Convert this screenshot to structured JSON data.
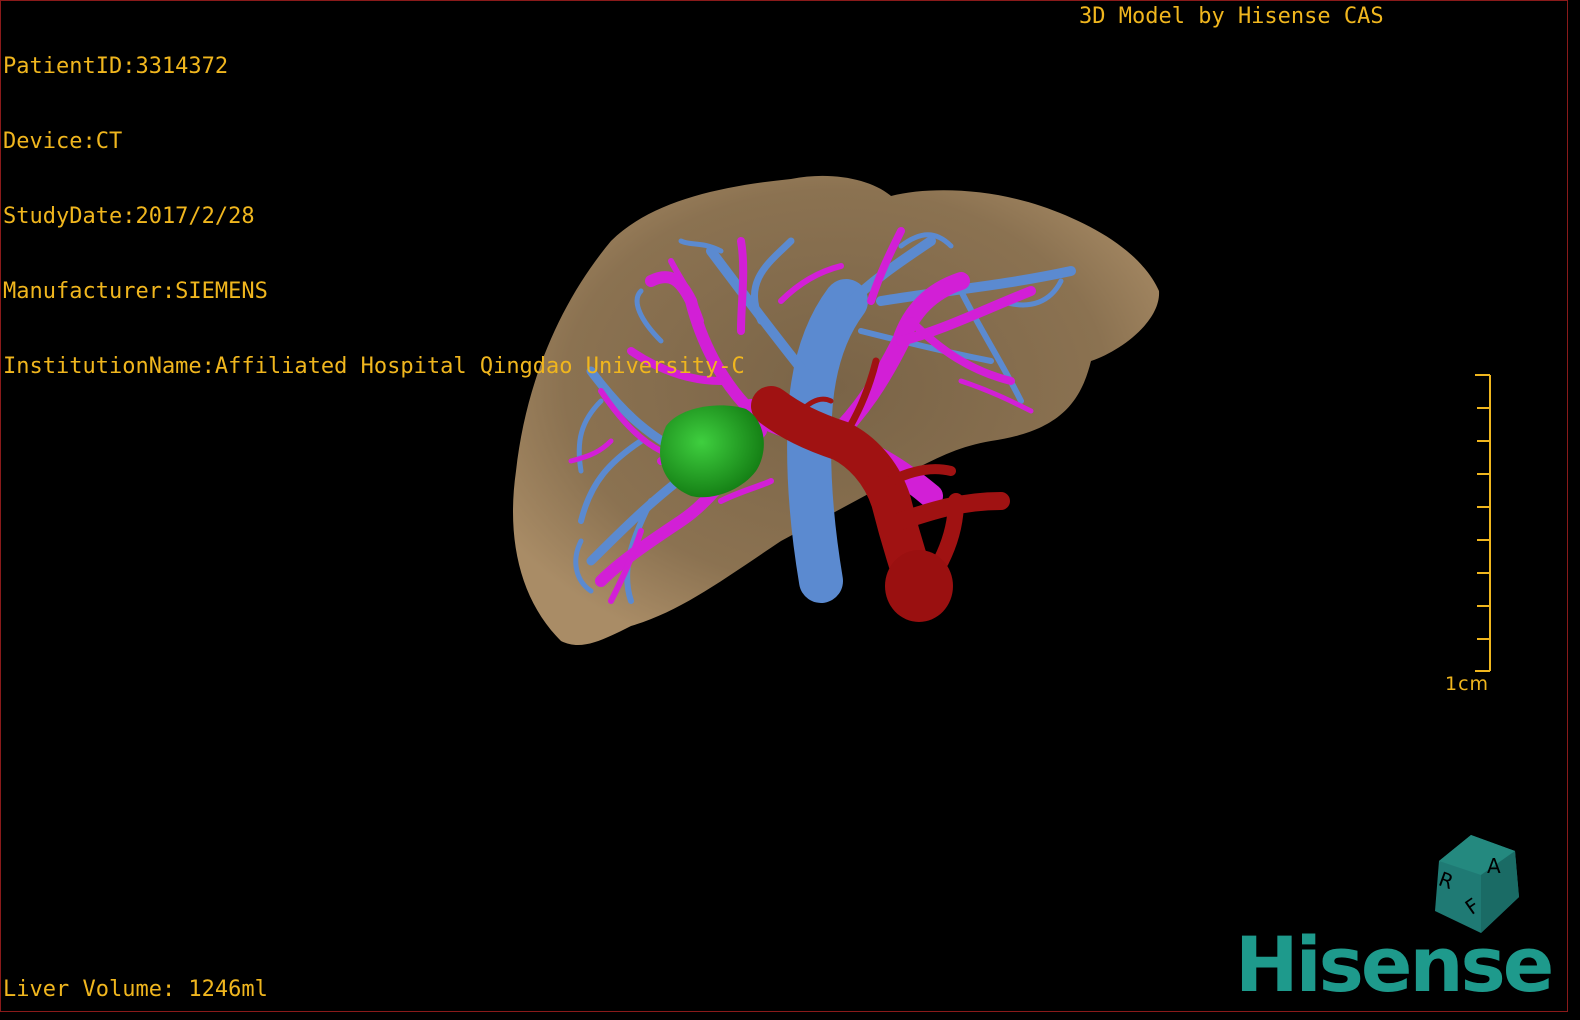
{
  "patient_info": {
    "patient_id": "PatientID:3314372",
    "device": "Device:CT",
    "study_date": "StudyDate:2017/2/28",
    "manufacturer": "Manufacturer:SIEMENS",
    "institution": "InstitutionName:Affiliated Hospital Qingdao University-C"
  },
  "credit": "3D Model by Hisense CAS",
  "liver_volume": "Liver Volume: 1246ml",
  "scale": {
    "label": "1cm"
  },
  "orientation_cube": {
    "letters": [
      "R",
      "A",
      "F"
    ],
    "color": "#1f7a74"
  },
  "brand": {
    "logo_text": "Hisense",
    "color": "#1e9a8c"
  },
  "colors": {
    "overlay_text": "#f0b61e",
    "liver": "#8b7251",
    "portal_vein": "#d21fd6",
    "hepatic_vein": "#5b8ad0",
    "hepatic_artery": "#a01212",
    "tumor": "#1a9a1a"
  }
}
